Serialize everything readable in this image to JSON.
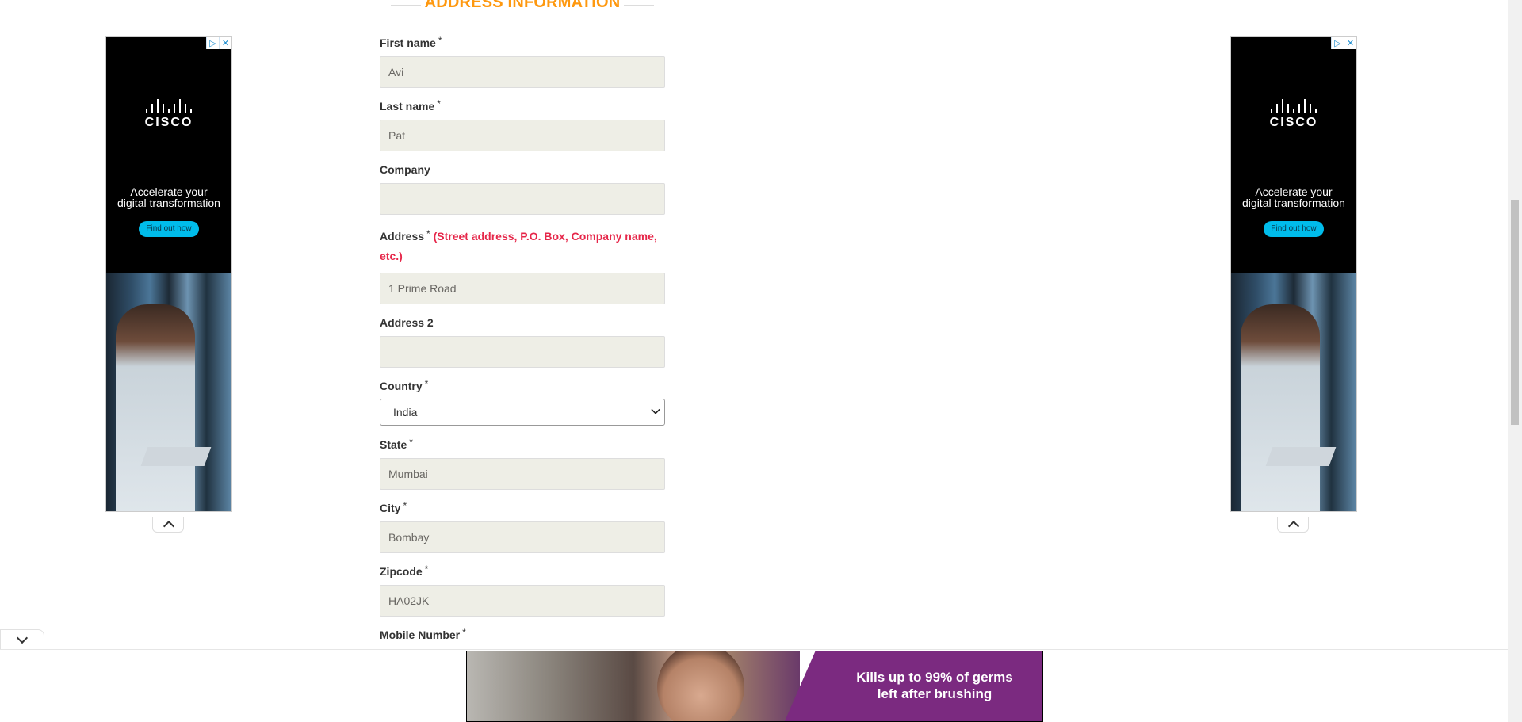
{
  "section": {
    "heading": "ADDRESS INFORMATION"
  },
  "form": {
    "required_mark": "*",
    "first_name": {
      "label": "First name",
      "value": "Avi"
    },
    "last_name": {
      "label": "Last name",
      "value": "Pat"
    },
    "company": {
      "label": "Company",
      "value": ""
    },
    "address": {
      "label": "Address",
      "note": "(Street address, P.O. Box, Company name, etc.)",
      "value": "1 Prime Road"
    },
    "address2": {
      "label": "Address 2",
      "value": ""
    },
    "country": {
      "label": "Country",
      "selected": "India"
    },
    "state": {
      "label": "State",
      "value": "Mumbai"
    },
    "city": {
      "label": "City",
      "value": "Bombay"
    },
    "zipcode": {
      "label": "Zipcode",
      "value": "HA02JK"
    },
    "mobile": {
      "label": "Mobile Number"
    }
  },
  "side_ad": {
    "brand": "CISCO",
    "headline_line1": "Accelerate your",
    "headline_line2": "digital transformation",
    "cta": "Find out how",
    "adchoices_icon": "adchoices-icon",
    "close_icon": "close-icon"
  },
  "bottom_ad": {
    "line1": "Kills up to 99% of germs",
    "line2": "left after brushing"
  },
  "colors": {
    "heading": "#fe980f",
    "note": "#e6274a",
    "input_bg": "#eeeee6",
    "cta": "#00bceb",
    "ad_purple": "#7b2a80"
  }
}
